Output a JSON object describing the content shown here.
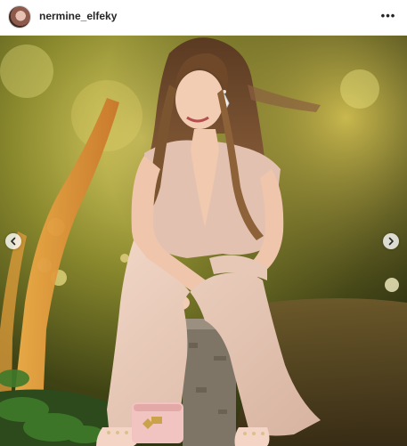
{
  "post": {
    "username": "nermine_elfeky",
    "more_icon": "more-options-icon",
    "avatar_icon": "avatar",
    "photo_subject": "photo",
    "nav": {
      "prev_icon": "chevron-left-icon",
      "next_icon": "chevron-right-icon"
    },
    "colors": {
      "header_bg": "#ffffff",
      "text": "#262626",
      "border": "#efefef"
    }
  }
}
